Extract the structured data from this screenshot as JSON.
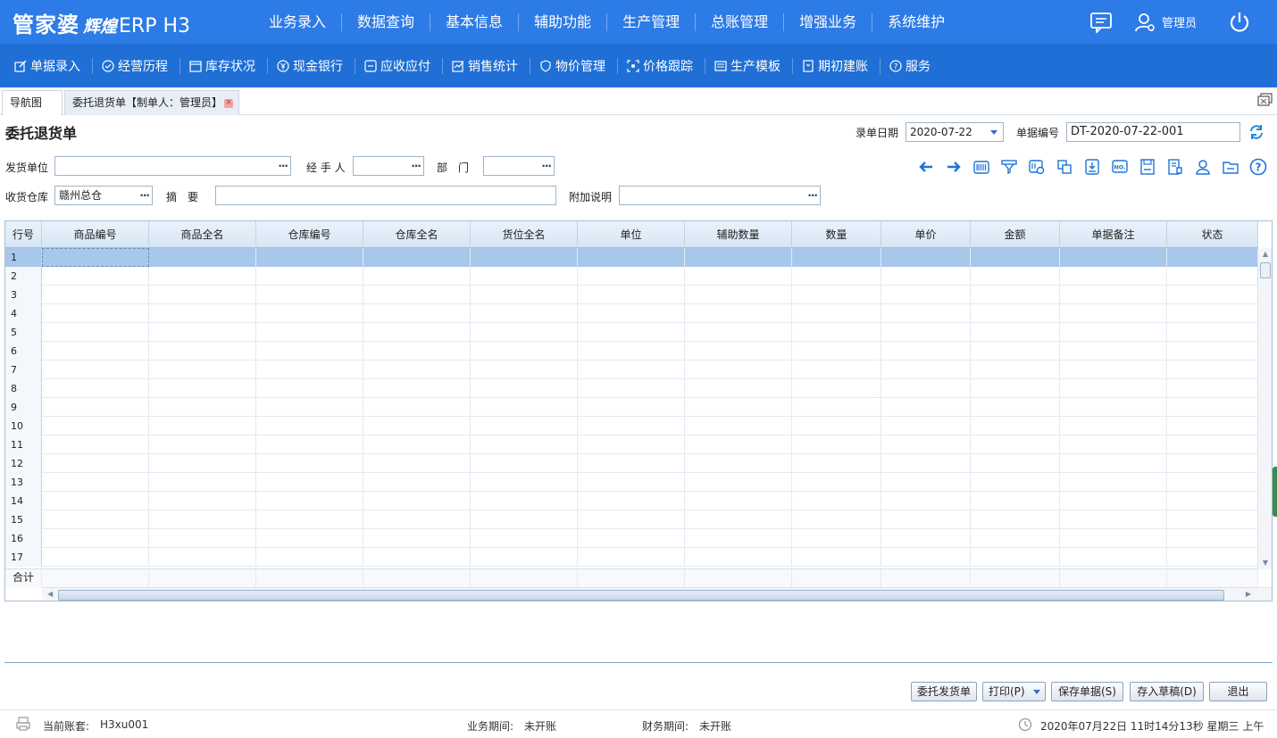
{
  "app": {
    "logo_main": "管家婆",
    "logo_sub": "辉煌",
    "logo_product": "ERP H3",
    "user_label": "管理员"
  },
  "main_nav": [
    "业务录入",
    "数据查询",
    "基本信息",
    "辅助功能",
    "生产管理",
    "总账管理",
    "增强业务",
    "系统维护"
  ],
  "sub_nav": [
    {
      "label": "单据录入",
      "icon": "edit-icon"
    },
    {
      "label": "经营历程",
      "icon": "check-circle-icon"
    },
    {
      "label": "库存状况",
      "icon": "calendar-icon"
    },
    {
      "label": "现金银行",
      "icon": "yuan-icon"
    },
    {
      "label": "应收应付",
      "icon": "ledger-icon"
    },
    {
      "label": "销售统计",
      "icon": "stats-icon"
    },
    {
      "label": "物价管理",
      "icon": "shield-icon"
    },
    {
      "label": "价格跟踪",
      "icon": "track-icon"
    },
    {
      "label": "生产模板",
      "icon": "template-icon"
    },
    {
      "label": "期初建账",
      "icon": "book-icon"
    },
    {
      "label": "服务",
      "icon": "help-icon"
    }
  ],
  "tabs": [
    {
      "label": "导航图"
    },
    {
      "label": "委托退货单【制单人：管理员】"
    }
  ],
  "form": {
    "title": "委托退货单",
    "date_label": "录单日期",
    "date_value": "2020-07-22",
    "number_label": "单据编号",
    "number_value": "DT-2020-07-22-001",
    "sender_label": "发货单位",
    "sender_value": "",
    "handler_label": "经 手 人",
    "handler_value": "",
    "dept_label": "部　门",
    "dept_value": "",
    "warehouse_label": "收货仓库",
    "warehouse_value": "赣州总仓",
    "summary_label": "摘　要",
    "summary_value": "",
    "note_label": "附加说明",
    "note_value": "",
    "dots": "···"
  },
  "toolbar_icons": [
    "arrow-left-icon",
    "arrow-right-icon",
    "barcode-icon",
    "filter-icon",
    "scan-icon",
    "copy-icon",
    "import-icon",
    "number-icon",
    "save-icon",
    "batch-icon",
    "user-icon",
    "folder-icon",
    "help-icon"
  ],
  "grid": {
    "columns": [
      "行号",
      "商品编号",
      "商品全名",
      "仓库编号",
      "仓库全名",
      "货位全名",
      "单位",
      "辅助数量",
      "数量",
      "单价",
      "金额",
      "单据备注",
      "状态"
    ],
    "rows": [
      "1",
      "2",
      "3",
      "4",
      "5",
      "6",
      "7",
      "8",
      "9",
      "10",
      "11",
      "12",
      "13",
      "14",
      "15",
      "16",
      "17"
    ],
    "total_label": "合计"
  },
  "buttons": {
    "entrust_ship": "委托发货单",
    "print": "打印(P)",
    "save": "保存单据(S)",
    "draft": "存入草稿(D)",
    "exit": "退出"
  },
  "status": {
    "account_label": "当前账套:",
    "account_value": "H3xu001",
    "biz_period_label": "业务期间:",
    "biz_period_value": "未开账",
    "fin_period_label": "财务期间:",
    "fin_period_value": "未开账",
    "datetime": "2020年07月22日 11时14分13秒 星期三 上午"
  },
  "colors": {
    "topbar": "#2d7be6",
    "subbar": "#1f6fd6",
    "selected_row": "#a7c8ea",
    "icon_blue": "#1d74d8"
  }
}
